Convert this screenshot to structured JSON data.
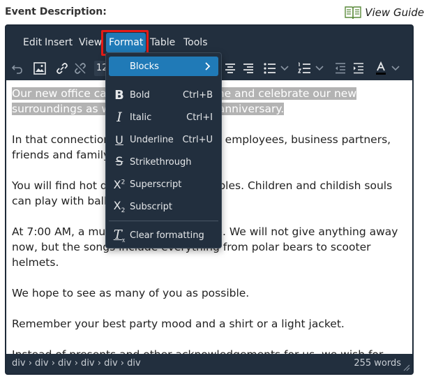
{
  "header": {
    "field_label": "Event Description:",
    "guide_label": "View Guide"
  },
  "menubar": {
    "items": [
      {
        "label": "Edit"
      },
      {
        "label": "Insert"
      },
      {
        "label": "View"
      },
      {
        "label": "Format"
      },
      {
        "label": "Table"
      },
      {
        "label": "Tools"
      }
    ],
    "active": "Format"
  },
  "toolbar": {
    "font_size": "12",
    "icons": [
      "undo-icon",
      "image-icon",
      "link-icon",
      "unlink-icon",
      "align-center-icon",
      "align-right-icon",
      "bullet-list-icon",
      "numbered-list-icon",
      "outdent-icon",
      "indent-icon",
      "text-color-icon"
    ]
  },
  "content": {
    "paragraphs": [
      {
        "hl": "Our new office cal",
        "rest_hl": "ome and celebrate our new surroundings as w",
        "rest_hl2": "0th anniversary.",
        "mid1": "",
        "mid2": ""
      },
      {
        "text_a": "In that connection",
        "text_b": "ful employees, business partners, friends and family"
      },
      {
        "text_a": "You will find hot d",
        "text_b": "ubbles. Children and childish souls can play with ballo"
      },
      {
        "text_a": "At 7:00 AM, a mus",
        "text_b": "up. We will not give anything away now, but the songs include everything from polar bears to scooter helmets."
      },
      {
        "text": "We hope to see as many of you as possible."
      },
      {
        "text": "Remember your best party mood and a shirt or a light jacket."
      },
      {
        "text": "Instead of presents and other acknowledgements for us, we wish for"
      }
    ]
  },
  "statusbar": {
    "path": "div › div › div › div › div › div",
    "word_count": "255 words"
  },
  "format_menu": {
    "items": [
      {
        "label": "Blocks",
        "shortcut": "",
        "icon": "chevron-right-icon"
      },
      {
        "label": "Bold",
        "shortcut": "Ctrl+B",
        "icon": "bold-icon"
      },
      {
        "label": "Italic",
        "shortcut": "Ctrl+I",
        "icon": "italic-icon"
      },
      {
        "label": "Underline",
        "shortcut": "Ctrl+U",
        "icon": "underline-icon"
      },
      {
        "label": "Strikethrough",
        "shortcut": "",
        "icon": "strikethrough-icon"
      },
      {
        "label": "Superscript",
        "shortcut": "",
        "icon": "superscript-icon"
      },
      {
        "label": "Subscript",
        "shortcut": "",
        "icon": "subscript-icon"
      },
      {
        "label": "Clear formatting",
        "shortcut": "",
        "icon": "clear-formatting-icon"
      }
    ]
  },
  "colors": {
    "editor_bg": "#222f3e",
    "accent": "#207ab7",
    "focus_ring": "#e41b17"
  }
}
